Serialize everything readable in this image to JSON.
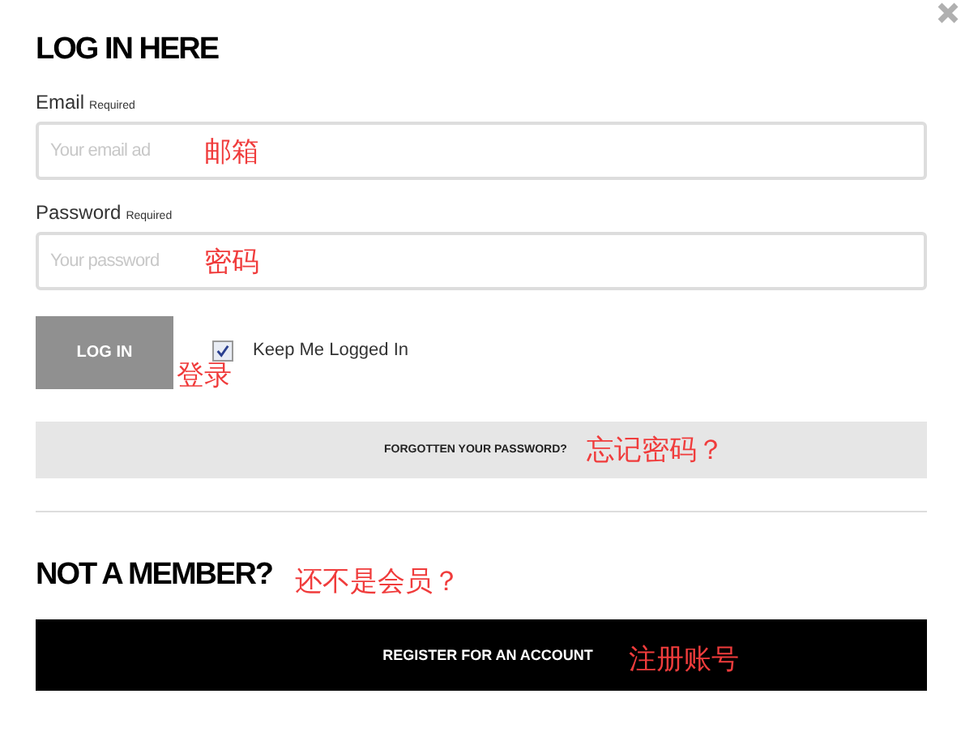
{
  "title": "LOG IN HERE",
  "fields": [
    {
      "label": "Email",
      "required": "Required",
      "placeholder": "Your email ad",
      "annotation": "邮箱"
    },
    {
      "label": "Password",
      "required": "Required",
      "placeholder": "Your password",
      "annotation": "密码"
    }
  ],
  "login_button": {
    "label": "LOG IN",
    "annotation": "登录"
  },
  "remember": {
    "label": "Keep Me Logged In",
    "checked": true
  },
  "forgot": {
    "label": "FORGOTTEN YOUR PASSWORD?",
    "annotation": "忘记密码？"
  },
  "member_heading": {
    "label": "NOT A MEMBER?",
    "annotation": "还不是会员？"
  },
  "register": {
    "label": "REGISTER FOR AN ACCOUNT",
    "annotation": "注册账号"
  }
}
